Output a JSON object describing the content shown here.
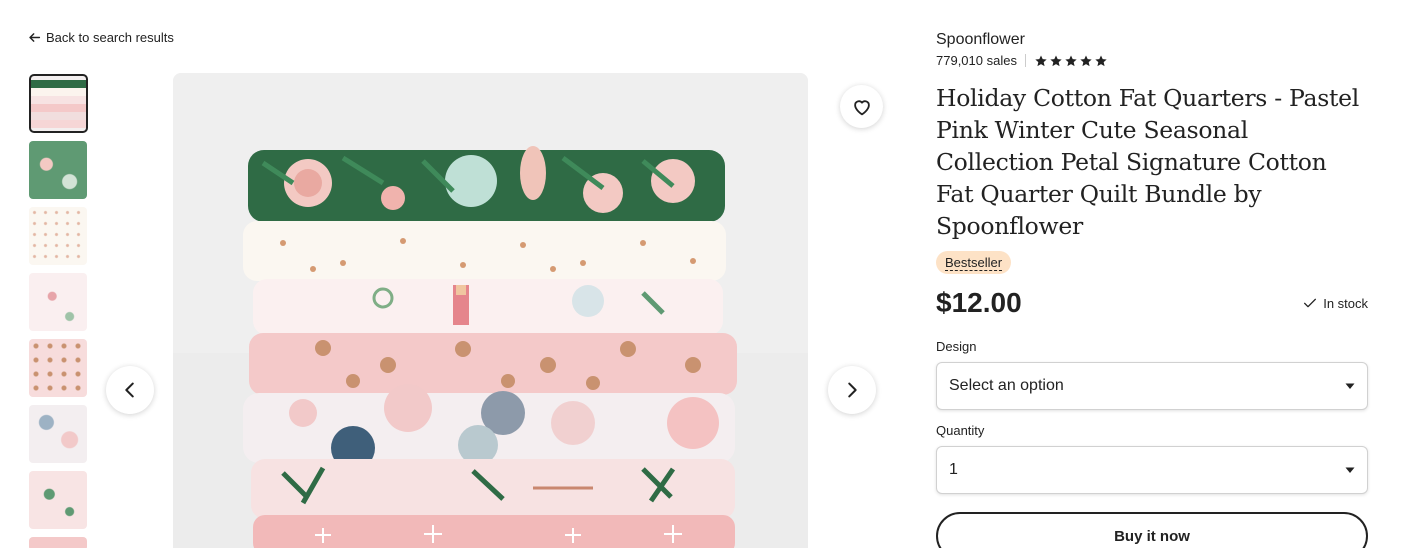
{
  "nav": {
    "back_label": "Back to search results"
  },
  "gallery": {
    "thumbnail_count": 8,
    "selected_index": 0
  },
  "shop": {
    "name": "Spoonflower",
    "sales": "779,010 sales",
    "rating": 5
  },
  "listing": {
    "title": "Holiday Cotton Fat Quarters - Pastel Pink Winter Cute Seasonal Collection Petal Signature Cotton Fat Quarter Quilt Bundle by Spoonflower",
    "badge": "Bestseller",
    "price": "$12.00",
    "stock": "In stock"
  },
  "form": {
    "design_label": "Design",
    "design_value": "Select an option",
    "quantity_label": "Quantity",
    "quantity_value": "1",
    "buy_label": "Buy it now"
  },
  "colors": {
    "text": "#222222",
    "badge_bg": "#fde2c6",
    "fabric_green": "#2f6b45",
    "fabric_pink": "#f4c9c9",
    "fabric_cream": "#fbf7f1"
  }
}
